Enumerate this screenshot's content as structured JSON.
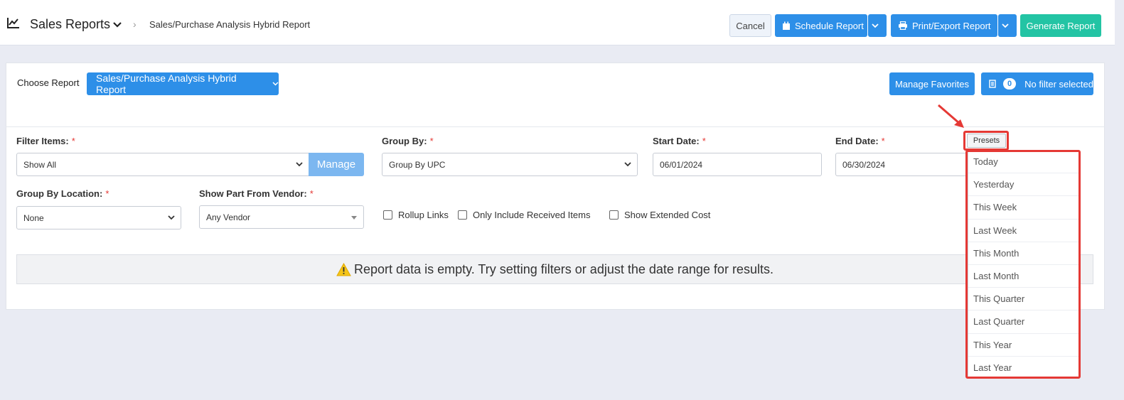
{
  "header": {
    "module_title": "Sales Reports",
    "breadcrumb_current": "Sales/Purchase Analysis Hybrid Report",
    "cancel_label": "Cancel",
    "schedule_label": "Schedule Report",
    "print_label": "Print/Export Report",
    "generate_label": "Generate Report",
    "accent_color": "#2d8fe8",
    "generate_color": "#23c4a4"
  },
  "report_bar": {
    "choose_label": "Choose Report",
    "selected_report": "Sales/Purchase Analysis Hybrid Report",
    "manage_favorites_label": "Manage Favorites",
    "filter_count": "0",
    "filter_label": "No filter selected"
  },
  "filters": {
    "filter_items": {
      "label": "Filter Items:",
      "required_mark": "*",
      "value": "Show All",
      "manage_label": "Manage"
    },
    "group_by": {
      "label": "Group By:",
      "required_mark": "*",
      "value": "Group By UPC"
    },
    "start_date": {
      "label": "Start Date:",
      "required_mark": "*",
      "value": "06/01/2024"
    },
    "end_date": {
      "label": "End Date:",
      "required_mark": "*",
      "value": "06/30/2024"
    },
    "group_by_location": {
      "label": "Group By Location:",
      "required_mark": "*",
      "value": "None"
    },
    "show_part_from_vendor": {
      "label": "Show Part From Vendor:",
      "required_mark": "*",
      "value": "Any Vendor"
    },
    "checkboxes": {
      "rollup_links": {
        "label": "Rollup Links",
        "checked": false
      },
      "only_received": {
        "label": "Only Include Received Items",
        "checked": false
      },
      "show_extended_cost": {
        "label": "Show Extended Cost",
        "checked": false
      }
    }
  },
  "alert": {
    "message": "Report data is empty. Try setting filters or adjust the date range for results.",
    "icon": "warning-icon"
  },
  "presets": {
    "button_label": "Presets",
    "items": [
      "Today",
      "Yesterday",
      "This Week",
      "Last Week",
      "This Month",
      "Last Month",
      "This Quarter",
      "Last Quarter",
      "This Year",
      "Last Year"
    ],
    "highlight_color": "#e53935"
  }
}
